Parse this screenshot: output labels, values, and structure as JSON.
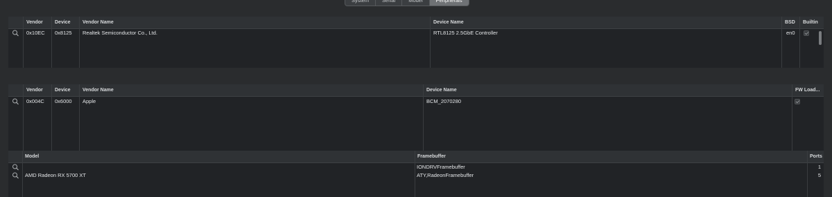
{
  "tabs": [
    {
      "label": "System",
      "active": false
    },
    {
      "label": "Serial",
      "active": false
    },
    {
      "label": "Model",
      "active": false
    },
    {
      "label": "Peripherals",
      "active": true
    }
  ],
  "network_table": {
    "headers": {
      "vendor": "Vendor",
      "device": "Device",
      "vendor_name": "Vendor Name",
      "device_name": "Device Name",
      "bsd": "BSD",
      "builtin": "Builtin"
    },
    "rows": [
      {
        "vendor": "0x10EC",
        "device": "0x8125",
        "vendor_name": "Realtek Semiconductor Co., Ltd.",
        "device_name": "RTL8125 2.5GbE Controller",
        "bsd": "en0",
        "builtin": true
      }
    ]
  },
  "bluetooth_table": {
    "headers": {
      "vendor": "Vendor",
      "device": "Device",
      "vendor_name": "Vendor Name",
      "device_name": "Device Name",
      "fw_loader": "FW Load..."
    },
    "rows": [
      {
        "vendor": "0x004C",
        "device": "0x6000",
        "vendor_name": "Apple",
        "device_name": "BCM_2070280",
        "fw_loader": true
      }
    ]
  },
  "graphics_table": {
    "headers": {
      "model": "Model",
      "framebuffer": "Framebuffer",
      "ports": "Ports"
    },
    "rows": [
      {
        "model": "",
        "framebuffer": "IONDRVFramebuffer",
        "ports": "1"
      },
      {
        "model": "AMD Radeon RX 5700 XT",
        "framebuffer": "ATY,RadeonFramebuffer",
        "ports": "5"
      }
    ]
  },
  "icons": {
    "row_action": "magnifier-icon",
    "checkbox": "checkmark-icon"
  },
  "colors": {
    "background": "#2a2c2e",
    "table_body": "#212326",
    "header": "#2f3235",
    "active_tab": "#6f7275"
  }
}
